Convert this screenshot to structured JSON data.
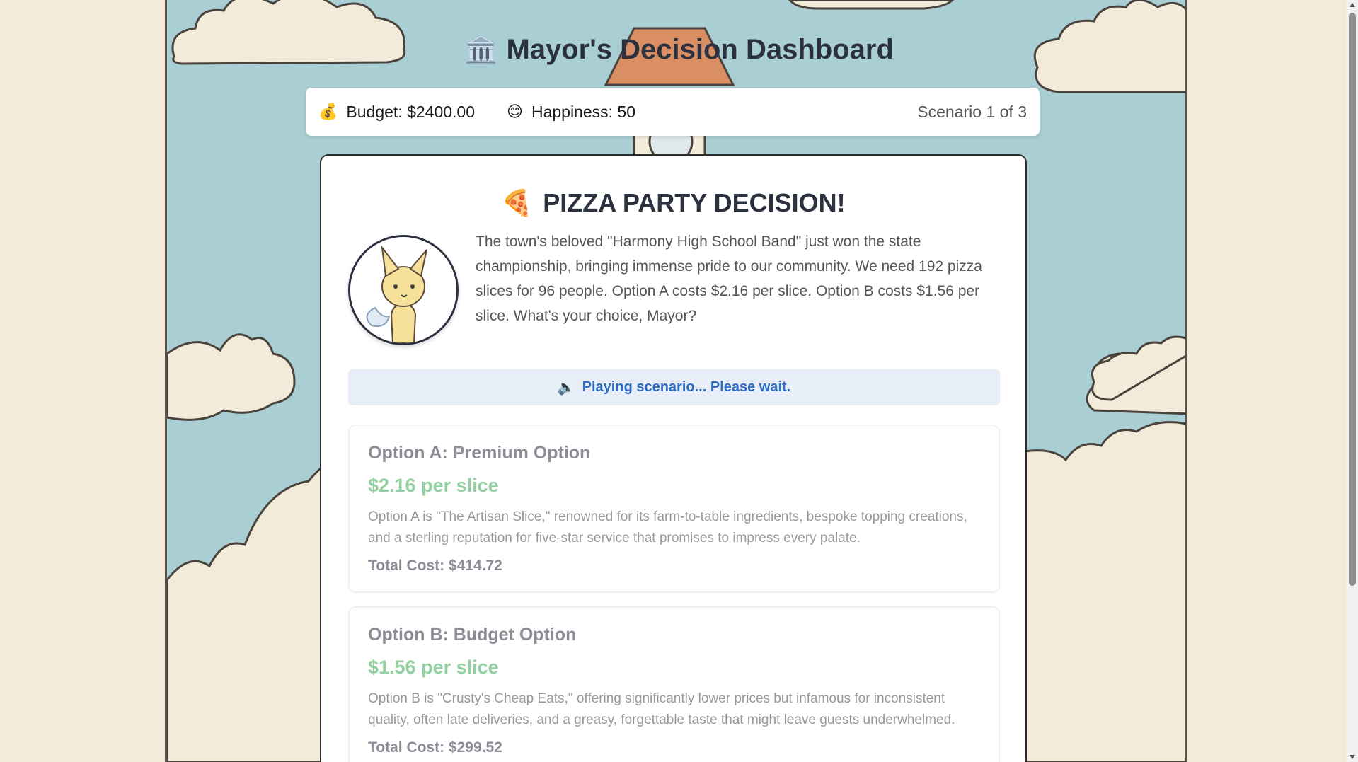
{
  "header": {
    "icon": "bank-building-icon",
    "title": "Mayor's Decision Dashboard"
  },
  "status": {
    "budget_label": "Budget: $2400.00",
    "happiness_label": "Happiness: 50",
    "scenario_label": "Scenario 1 of 3"
  },
  "scenario": {
    "icon": "pizza-icon",
    "title": "PIZZA PARTY DECISION!",
    "description": "The town's beloved \"Harmony High School Band\" just won the state championship, bringing immense pride to our community. We need 192 pizza slices for 96 people. Option A costs $2.16 per slice. Option B costs $1.56 per slice. What's your choice, Mayor?",
    "notice": "Playing scenario... Please wait."
  },
  "options": [
    {
      "title": "Option A: Premium Option",
      "price": "$2.16 per slice",
      "description": "Option A is \"The Artisan Slice,\" renowned for its farm-to-table ingredients, bespoke topping creations, and a sterling reputation for five-star service that promises to impress every palate.",
      "total": "Total Cost: $414.72"
    },
    {
      "title": "Option B: Budget Option",
      "price": "$1.56 per slice",
      "description": "Option B is \"Crusty's Cheap Eats,\" offering significantly lower prices but infamous for inconsistent quality, often late deliveries, and a greasy, forgettable taste that might leave guests underwhelmed.",
      "total": "Total Cost: $299.52"
    }
  ],
  "colors": {
    "sky": "#a9cfd4",
    "cloud": "#f3ebda",
    "accent_green": "#3cab55",
    "notice_blue": "#2d6cc0"
  }
}
